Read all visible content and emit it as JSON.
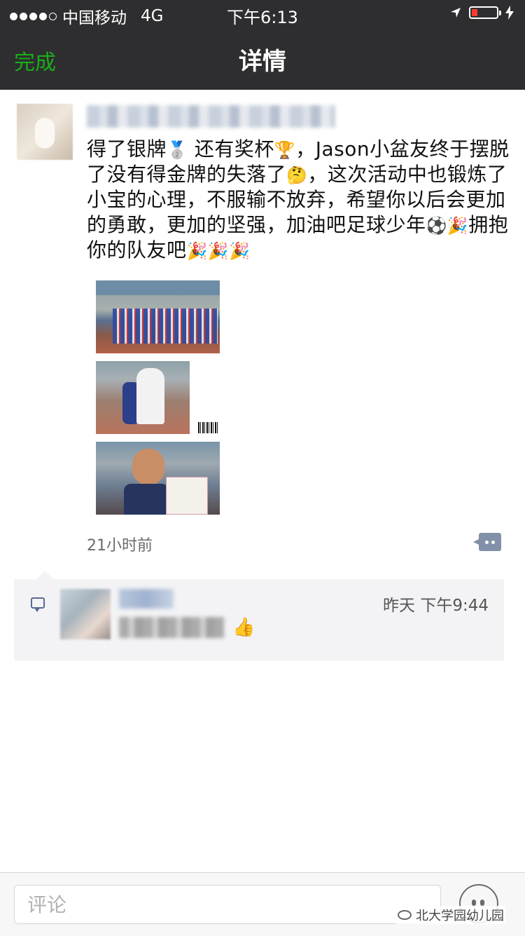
{
  "status_bar": {
    "carrier": "中国移动",
    "network": "4G",
    "time": "下午6:13",
    "battery_color": "#ff3b30"
  },
  "nav": {
    "done_label": "完成",
    "title": "详情",
    "accent": "#1aad19"
  },
  "post": {
    "text_before_medal": "得了银牌",
    "text_before_trophy": "还有奖杯",
    "text_1": "，Jason小盆友终于摆脱了没有得金牌的失落了",
    "text_2": "，这次活动中也锻炼了小宝的心理，不服输不放弃，希望你以后会更加的勇敢，更加的坚强，加油吧足球少年",
    "text_3": "拥抱你的队友吧",
    "emoji_medal": "🥈",
    "emoji_trophy": "🏆",
    "emoji_thinking": "🤔",
    "emoji_ball": "⚽",
    "emoji_party": "🎉",
    "time_ago": "21小时前"
  },
  "comment": {
    "time": "昨天 下午9:44",
    "emoji": "👍"
  },
  "input": {
    "placeholder": "评论"
  },
  "watermark": {
    "text": "北大学园幼儿园"
  }
}
